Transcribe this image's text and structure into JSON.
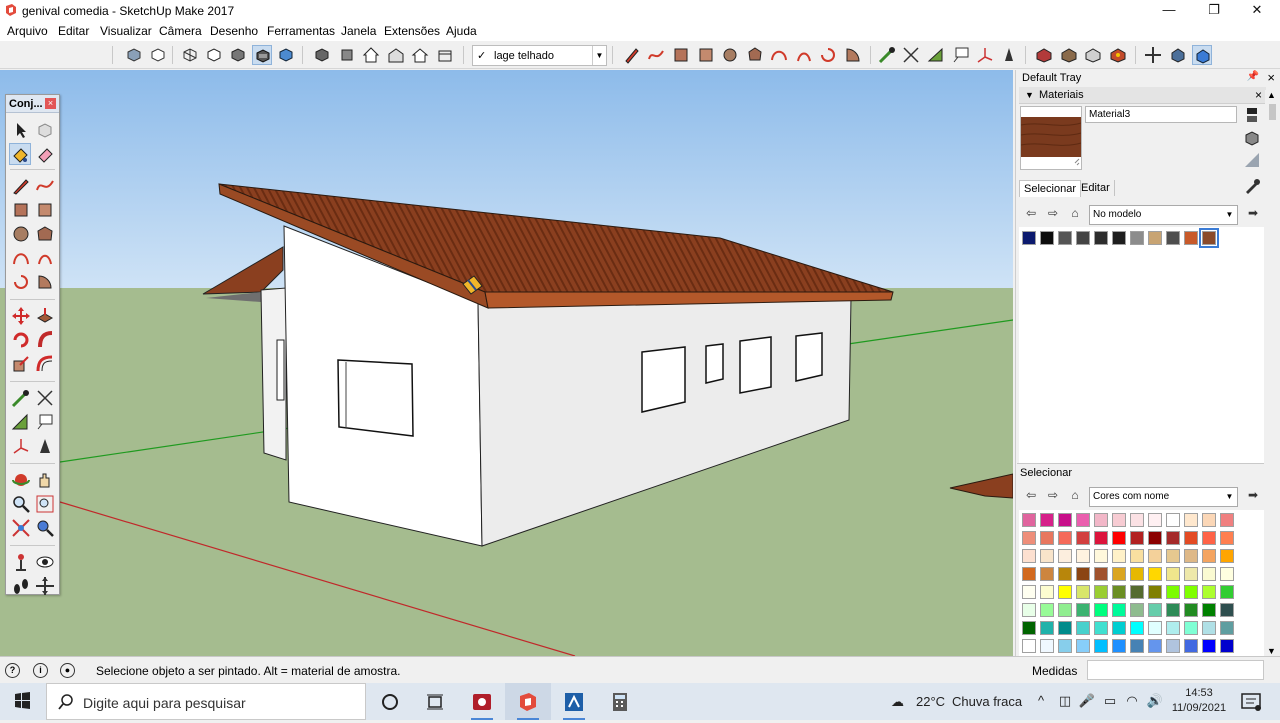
{
  "window": {
    "title": "genival comedia - SketchUp Make 2017",
    "minimize": "—",
    "maximize": "❐",
    "close": "✕"
  },
  "menu": [
    "Arquivo",
    "Editar",
    "Visualizar",
    "Câmera",
    "Desenho",
    "Ferramentas",
    "Janela",
    "Extensões",
    "Ajuda"
  ],
  "toolbar": {
    "scene_check": "✓",
    "scene_value": "lage telhado"
  },
  "tools_panel": {
    "title": "Conj...",
    "close": "×"
  },
  "tray": {
    "title": "Default Tray",
    "section": "Materiais",
    "material_name": "Material3",
    "tab_select": "Selecionar",
    "tab_edit": "Editar",
    "collection_top": "No modelo",
    "lower_title": "Selecionar",
    "collection_bottom": "Cores com nome"
  },
  "status": {
    "message": "Selecione objeto a ser pintado. Alt = material de amostra.",
    "measures_label": "Medidas"
  },
  "taskbar": {
    "search_placeholder": "Digite aqui para pesquisar",
    "weather_temp": "22°C",
    "weather_desc": "Chuva fraca",
    "time": "14:53",
    "date": "11/09/2021"
  },
  "colors": {
    "sky": "#9ec4ec",
    "ground": "#a5bc8f",
    "roof": "#8a3f1f",
    "wall": "#ffffff",
    "accent": "#3a7bd5"
  },
  "model_swatches": [
    "#0c1a6e",
    "#0d0d0d",
    "#555555",
    "#444444",
    "#2d2d2d",
    "#1e1e1e",
    "#8c8c8c",
    "#c8a473",
    "#4e4e4e",
    "#c85a2a",
    "#8a4a2a"
  ],
  "named_colors": [
    [
      "#e0659e",
      "#d6228a",
      "#c8108a",
      "#ea5fae",
      "#f2b7c8",
      "#f7ccd3",
      "#fbe1e4",
      "#fff0f2",
      "#ffffff",
      "#ffe8ce",
      "#fbd7b7",
      "#f08080"
    ],
    [
      "#ee8e7a",
      "#e8775f",
      "#f56a5a",
      "#d23f3f",
      "#dc143c",
      "#ff0000",
      "#b22222",
      "#8b0000",
      "#a52a2a",
      "#e34b24",
      "#ff6347",
      "#ff7f50"
    ],
    [
      "#fde0d0",
      "#f8e4ca",
      "#fceede",
      "#fff3e0",
      "#fff8dc",
      "#fff1c8",
      "#f9dfa0",
      "#f4d19a",
      "#e6c88f",
      "#deb887",
      "#f4a460",
      "#ffa500"
    ],
    [
      "#d2691e",
      "#cd853f",
      "#b8860b",
      "#8b4513",
      "#a0522d",
      "#daa520",
      "#e6b800",
      "#ffd700",
      "#f0e68c",
      "#eee8aa",
      "#fafad2",
      "#ffffe0"
    ],
    [
      "#fffff0",
      "#fdfdd0",
      "#ffff00",
      "#d8e66a",
      "#9acd32",
      "#6b8e23",
      "#556b2f",
      "#808000",
      "#7cfc00",
      "#7fff00",
      "#adff2f",
      "#32cd32"
    ],
    [
      "#e8ffe8",
      "#98fb98",
      "#90ee90",
      "#3cb371",
      "#00ff7f",
      "#00fa9a",
      "#8fbc8f",
      "#66cdaa",
      "#2e8b57",
      "#228b22",
      "#008000",
      "#2f4f4f"
    ],
    [
      "#006400",
      "#20b2aa",
      "#008b8b",
      "#48d1cc",
      "#40e0d0",
      "#00ced1",
      "#00ffff",
      "#e0ffff",
      "#afeeee",
      "#7fffd4",
      "#b0e0e6",
      "#5f9ea0"
    ],
    [
      "#ffffff",
      "#f0f8ff",
      "#87ceeb",
      "#87cefa",
      "#00bfff",
      "#1e90ff",
      "#4682b4",
      "#6495ed",
      "#b0c4de",
      "#4169e1",
      "#0000ff",
      "#0000cd"
    ]
  ]
}
